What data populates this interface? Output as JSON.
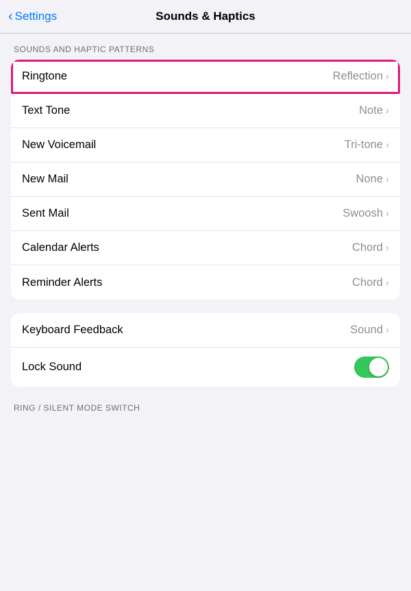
{
  "header": {
    "back_label": "Settings",
    "title": "Sounds & Haptics"
  },
  "section1": {
    "label": "SOUNDS AND HAPTIC PATTERNS",
    "rows": [
      {
        "id": "ringtone",
        "label": "Ringtone",
        "value": "Reflection",
        "highlighted": true
      },
      {
        "id": "text-tone",
        "label": "Text Tone",
        "value": "Note",
        "highlighted": false
      },
      {
        "id": "new-voicemail",
        "label": "New Voicemail",
        "value": "Tri-tone",
        "highlighted": false
      },
      {
        "id": "new-mail",
        "label": "New Mail",
        "value": "None",
        "highlighted": false
      },
      {
        "id": "sent-mail",
        "label": "Sent Mail",
        "value": "Swoosh",
        "highlighted": false
      },
      {
        "id": "calendar-alerts",
        "label": "Calendar Alerts",
        "value": "Chord",
        "highlighted": false
      },
      {
        "id": "reminder-alerts",
        "label": "Reminder Alerts",
        "value": "Chord",
        "highlighted": false
      }
    ]
  },
  "section2": {
    "rows": [
      {
        "id": "keyboard-feedback",
        "label": "Keyboard Feedback",
        "value": "Sound",
        "type": "chevron"
      },
      {
        "id": "lock-sound",
        "label": "Lock Sound",
        "value": "",
        "type": "toggle",
        "toggle_on": true
      }
    ]
  },
  "footer": {
    "label": "RING / SILENT MODE SWITCH"
  },
  "chevron": "›"
}
